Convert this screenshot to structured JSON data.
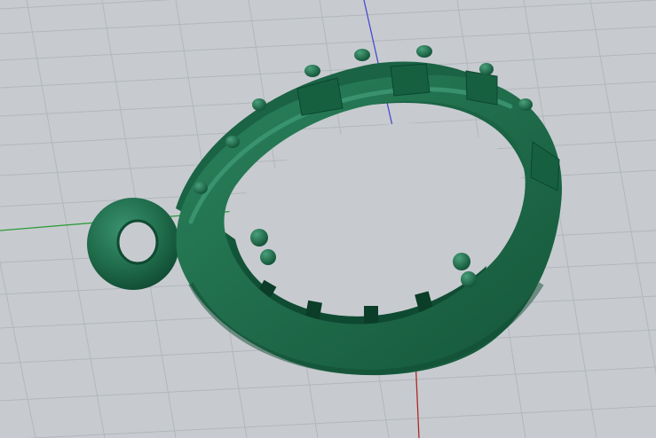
{
  "viewport": {
    "type": "3d-cad-perspective-view",
    "background_color": "#c7cbcf",
    "grid": true,
    "grid_line_color": "#b3b8bd",
    "axes": {
      "x_axis_color": "#b02a22",
      "y_axis_color": "#2e9a3a",
      "z_axis_color": "#4a4ad0"
    },
    "model": {
      "object": "teardrop-pendant-with-bail-loop",
      "material_color": "#1f6b4a",
      "highlight_color": "#3a9270",
      "shadow_color": "#0f4a32"
    }
  }
}
